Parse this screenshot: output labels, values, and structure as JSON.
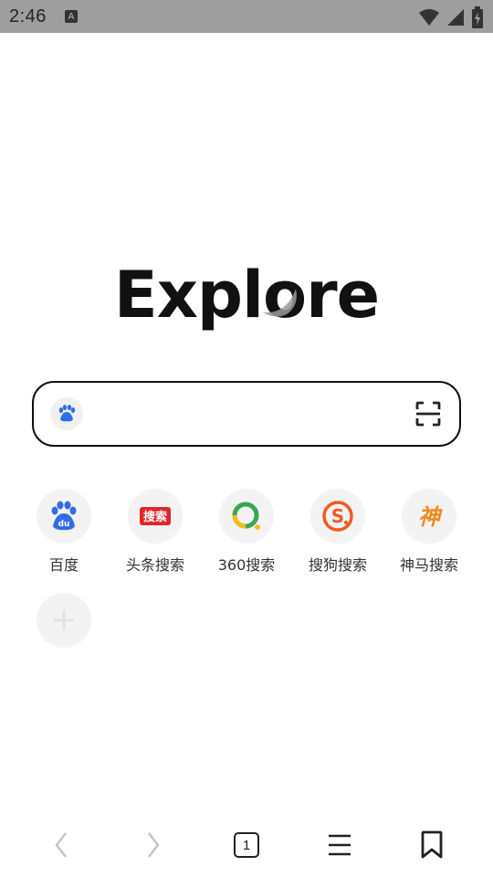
{
  "status_bar": {
    "time": "2:46",
    "notification_icon": "a-icon",
    "icons": [
      "wifi-icon",
      "signal-icon",
      "battery-icon"
    ]
  },
  "logo": {
    "text": "Explore",
    "accent_color": "#9a9a9a"
  },
  "search": {
    "placeholder": "",
    "value": "",
    "engine_icon": "baidu-paw-icon",
    "scan_icon": "scan-icon"
  },
  "shortcuts": [
    {
      "label": "百度",
      "icon": "baidu-icon",
      "color": "#2f6de8"
    },
    {
      "label": "头条搜索",
      "icon": "toutiao-search-icon",
      "color": "#e2252b"
    },
    {
      "label": "360搜索",
      "icon": "360-search-icon",
      "color": "#34a853"
    },
    {
      "label": "搜狗搜索",
      "icon": "sogou-search-icon",
      "color": "#f15a22"
    },
    {
      "label": "神马搜索",
      "icon": "shenma-search-icon",
      "color": "#f08a1c"
    }
  ],
  "add_shortcut": {
    "icon": "plus-icon"
  },
  "bottom_bar": {
    "back_icon": "chevron-left-icon",
    "forward_icon": "chevron-right-icon",
    "tab_count": "1",
    "menu_icon": "menu-icon",
    "bookmarks_icon": "bookmark-icon"
  }
}
